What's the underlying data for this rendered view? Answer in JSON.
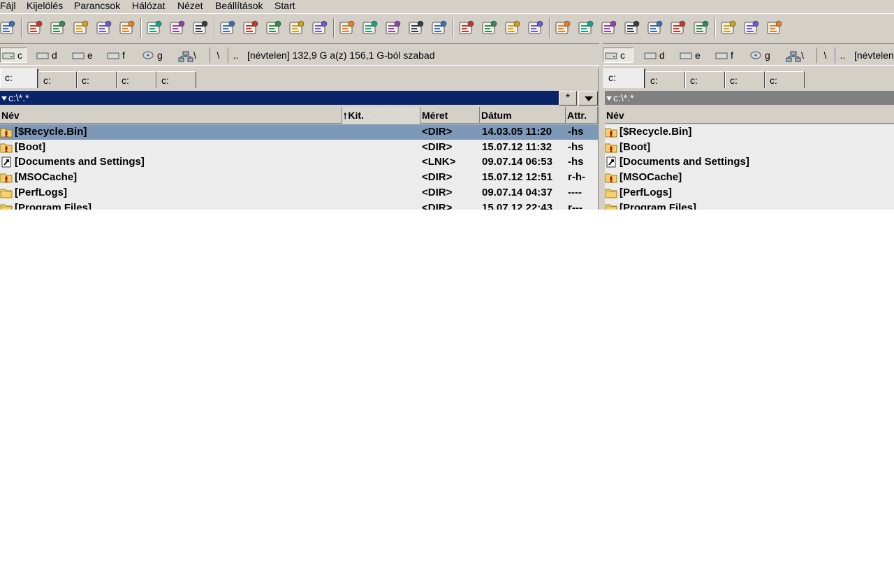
{
  "menu": [
    "Fájl",
    "Kijelölés",
    "Parancsok",
    "Hálózat",
    "Nézet",
    "Beállítások",
    "Start"
  ],
  "toolbar": {
    "icons": [
      "magnifier-icon",
      "brief-view-icon",
      "full-view-icon",
      "edit-icon",
      "pack-icon",
      "unpack-icon",
      "scissors-icon",
      "search-icon",
      "tree-icon",
      "wand-icon",
      "ftp-icon",
      "clock-icon",
      "cmd-icon",
      "refresh-icon",
      "notepad-icon",
      "compare-icon",
      "script-icon",
      "bug-icon",
      "calendar-icon",
      "nine-icon",
      "tools-icon",
      "swirl-icon",
      "book-icon",
      "zoom-icon",
      "monitor-icon",
      "screen-icon",
      "eraser-icon",
      "wrench-icon",
      "recycle-icon",
      "delete-icon",
      "gears-icon",
      "network-gears-icon",
      "settings-icon"
    ]
  },
  "left": {
    "drives": [
      "c",
      "d",
      "e",
      "f",
      "g",
      "\\"
    ],
    "root_button": "\\",
    "parent_button": "..",
    "drive_info": "[névtelen]  132,9 G a(z) 156,1 G-ból szabad",
    "tabs": [
      "c:",
      "c:",
      "c:",
      "c:",
      "c:"
    ],
    "path": "c:\\*.*",
    "filter_button": "*",
    "columns": {
      "name": "Név",
      "ext": "Kit.",
      "size": "Méret",
      "date": "Dátum",
      "attr": "Attr."
    },
    "files": [
      {
        "icon": "warning-folder-icon",
        "name": "[$Recycle.Bin]",
        "size": "<DIR>",
        "date": "14.03.05 11:20",
        "attr": "-hs"
      },
      {
        "icon": "warning-folder-icon",
        "name": "[Boot]",
        "size": "<DIR>",
        "date": "15.07.12 11:32",
        "attr": "-hs"
      },
      {
        "icon": "link-icon",
        "name": "[Documents and Settings]",
        "size": "<LNK>",
        "date": "09.07.14 06:53",
        "attr": "-hs"
      },
      {
        "icon": "warning-folder-icon",
        "name": "[MSOCache]",
        "size": "<DIR>",
        "date": "15.07.12 12:51",
        "attr": "r-h-"
      },
      {
        "icon": "folder-icon",
        "name": "[PerfLogs]",
        "size": "<DIR>",
        "date": "09.07.14 04:37",
        "attr": "----"
      },
      {
        "icon": "folder-icon",
        "name": "[Program Files]",
        "size": "<DIR>",
        "date": "15.07.12 22:43",
        "attr": "r---"
      }
    ]
  },
  "right": {
    "drives": [
      "c",
      "d",
      "e",
      "f",
      "g",
      "\\"
    ],
    "root_button": "\\",
    "parent_button": "..",
    "drive_info": "[névtelen]",
    "tabs": [
      "c:",
      "c:",
      "c:",
      "c:",
      "c:"
    ],
    "path": "c:\\*.*",
    "columns": {
      "name": "Név"
    },
    "files": [
      {
        "icon": "warning-folder-icon",
        "name": "[$Recycle.Bin]"
      },
      {
        "icon": "warning-folder-icon",
        "name": "[Boot]"
      },
      {
        "icon": "link-icon",
        "name": "[Documents and Settings]"
      },
      {
        "icon": "warning-folder-icon",
        "name": "[MSOCache]"
      },
      {
        "icon": "folder-icon",
        "name": "[PerfLogs]"
      },
      {
        "icon": "folder-icon",
        "name": "[Program Files]"
      }
    ]
  },
  "colors": {
    "active_path_bg": "#0a246a",
    "inactive_path_bg": "#808080",
    "selection": "#7e98b8",
    "chrome": "#d4d0c8",
    "folder": "#f5d36b"
  }
}
